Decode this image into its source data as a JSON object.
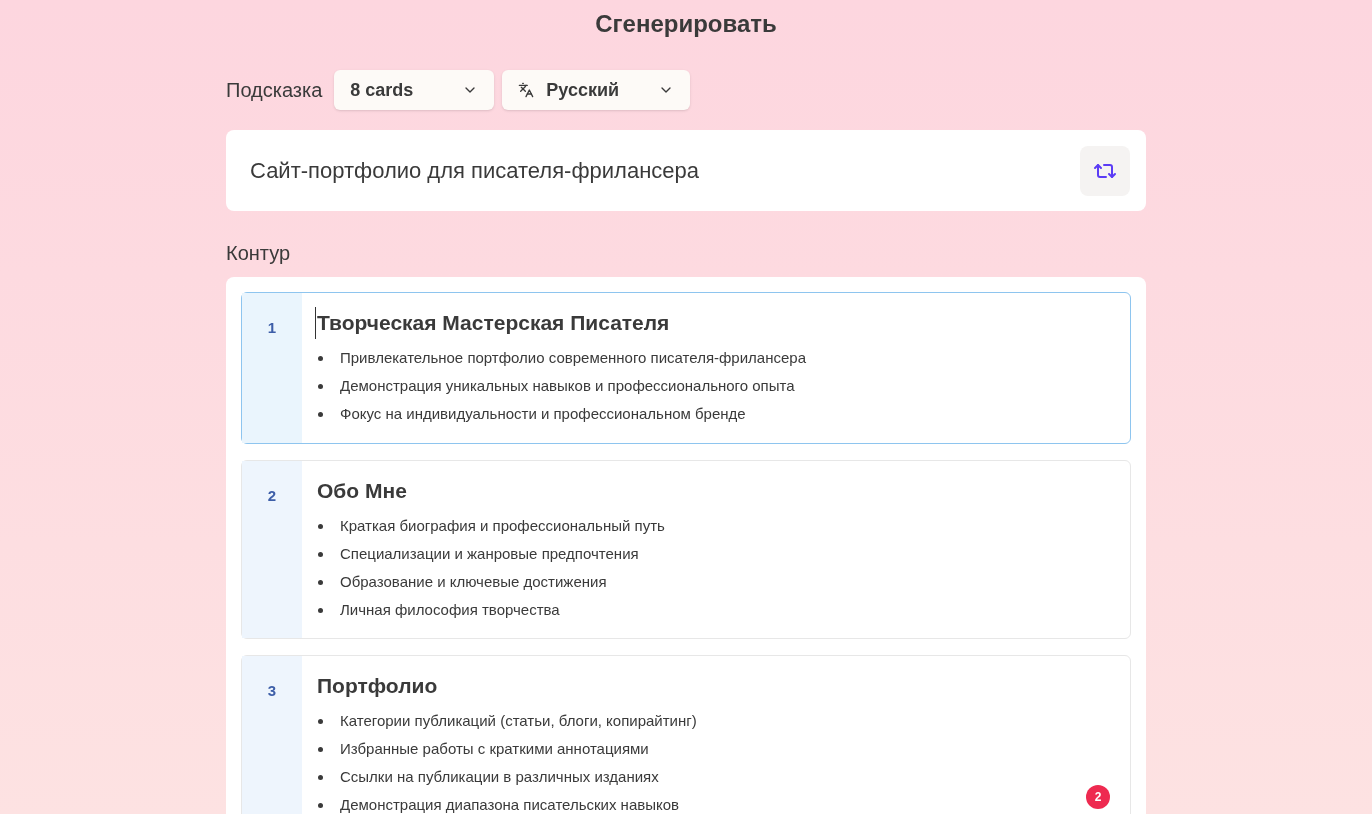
{
  "title": "Сгенерировать",
  "prompt_bar": {
    "label": "Подсказка",
    "card_count": "8 cards",
    "language": "Русский"
  },
  "prompt": {
    "value": "Сайт-портфолио для писателя-фрилансера"
  },
  "outline": {
    "label": "Контур",
    "cards": [
      {
        "number": "1",
        "title": "Творческая Мастерская Писателя",
        "selected": true,
        "bullets": [
          "Привлекательное портфолио современного писателя-фрилансера",
          "Демонстрация уникальных навыков и профессионального опыта",
          "Фокус на индивидуальности и профессиональном бренде"
        ]
      },
      {
        "number": "2",
        "title": "Обо Мне",
        "selected": false,
        "bullets": [
          "Краткая биография и профессиональный путь",
          "Специализации и жанровые предпочтения",
          "Образование и ключевые достижения",
          "Личная философия творчества"
        ]
      },
      {
        "number": "3",
        "title": "Портфолио",
        "selected": false,
        "bullets": [
          "Категории публикаций (статьи, блоги, копирайтинг)",
          "Избранные работы с краткими аннотациями",
          "Ссылки на публикации в различных изданиях",
          "Демонстрация диапазона писательских навыков"
        ]
      }
    ]
  },
  "notification_badge": "2"
}
